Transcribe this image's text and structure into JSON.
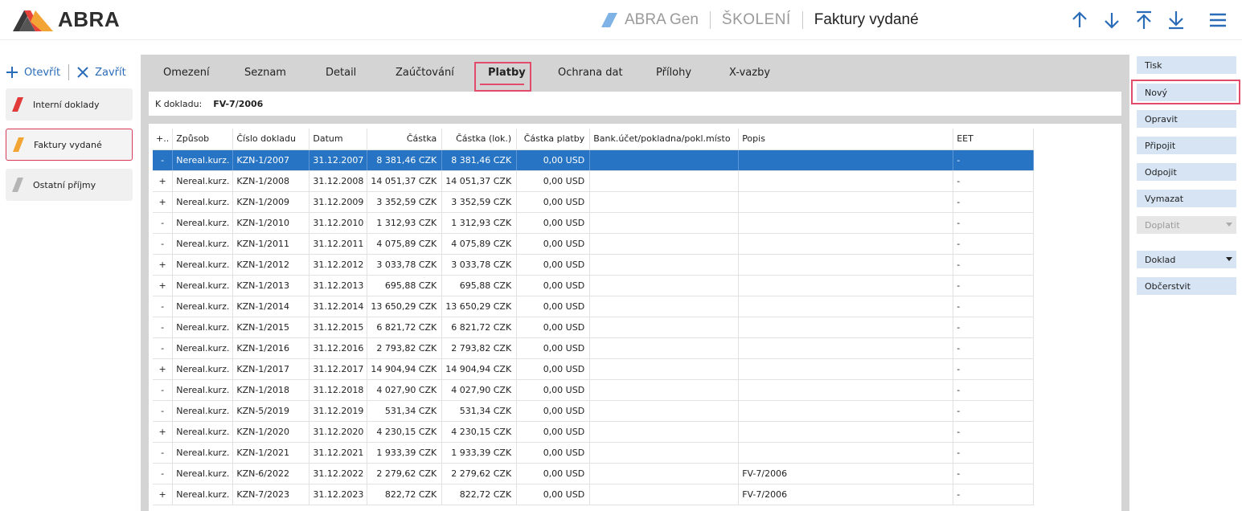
{
  "header": {
    "logo_text": "ABRA",
    "app_name": "ABRA Gen",
    "database": "ŠKOLENÍ",
    "title": "Faktury vydané",
    "nav_icons": [
      "arrow-up-icon",
      "arrow-down-icon",
      "arrow-first-icon",
      "arrow-last-icon",
      "menu-icon"
    ]
  },
  "colors": {
    "accent_blue": "#2b6cb8",
    "selected_row": "#2674c3",
    "highlight": "#e04c6a",
    "agenda_interni": "#e03a3a",
    "agenda_faktury": "#f2a535",
    "agenda_ostatni": "#b5b5b5"
  },
  "sidebar": {
    "open_label": "Otevřít",
    "close_label": "Zavřít",
    "items": [
      {
        "label": "Interní doklady",
        "icon": "red-stripe-icon"
      },
      {
        "label": "Faktury vydané",
        "icon": "orange-stripe-icon",
        "active": true
      },
      {
        "label": "Ostatní příjmy",
        "icon": "gray-stripe-icon"
      }
    ]
  },
  "tabs": [
    {
      "label": "Omezení"
    },
    {
      "label": "Seznam"
    },
    {
      "label": "Detail"
    },
    {
      "label": "Zaúčtování"
    },
    {
      "label": "Platby",
      "active": true
    },
    {
      "label": "Ochrana dat"
    },
    {
      "label": "Přílohy"
    },
    {
      "label": "X-vazby"
    }
  ],
  "doc": {
    "label": "K dokladu:",
    "value": "FV-7/2006"
  },
  "grid": {
    "columns": [
      "+..",
      "Způsob",
      "Číslo dokladu",
      "Datum",
      "Částka",
      "Částka (lok.)",
      "Částka platby",
      "Bank.účet/pokladna/pokl.místo",
      "Popis",
      "EET"
    ],
    "rows": [
      [
        "-",
        "Nereal.kurz.",
        "KZN-1/2007",
        "31.12.2007",
        "8 381,46 CZK",
        "8 381,46 CZK",
        "0,00 USD",
        "",
        "",
        "-"
      ],
      [
        "+",
        "Nereal.kurz.",
        "KZN-1/2008",
        "31.12.2008",
        "14 051,37 CZK",
        "14 051,37 CZK",
        "0,00 USD",
        "",
        "",
        "-"
      ],
      [
        "+",
        "Nereal.kurz.",
        "KZN-1/2009",
        "31.12.2009",
        "3 352,59 CZK",
        "3 352,59 CZK",
        "0,00 USD",
        "",
        "",
        "-"
      ],
      [
        "-",
        "Nereal.kurz.",
        "KZN-1/2010",
        "31.12.2010",
        "1 312,93 CZK",
        "1 312,93 CZK",
        "0,00 USD",
        "",
        "",
        "-"
      ],
      [
        "-",
        "Nereal.kurz.",
        "KZN-1/2011",
        "31.12.2011",
        "4 075,89 CZK",
        "4 075,89 CZK",
        "0,00 USD",
        "",
        "",
        "-"
      ],
      [
        "+",
        "Nereal.kurz.",
        "KZN-1/2012",
        "31.12.2012",
        "3 033,78 CZK",
        "3 033,78 CZK",
        "0,00 USD",
        "",
        "",
        "-"
      ],
      [
        "+",
        "Nereal.kurz.",
        "KZN-1/2013",
        "31.12.2013",
        "695,88 CZK",
        "695,88 CZK",
        "0,00 USD",
        "",
        "",
        "-"
      ],
      [
        "-",
        "Nereal.kurz.",
        "KZN-1/2014",
        "31.12.2014",
        "13 650,29 CZK",
        "13 650,29 CZK",
        "0,00 USD",
        "",
        "",
        "-"
      ],
      [
        "-",
        "Nereal.kurz.",
        "KZN-1/2015",
        "31.12.2015",
        "6 821,72 CZK",
        "6 821,72 CZK",
        "0,00 USD",
        "",
        "",
        "-"
      ],
      [
        "-",
        "Nereal.kurz.",
        "KZN-1/2016",
        "31.12.2016",
        "2 793,82 CZK",
        "2 793,82 CZK",
        "0,00 USD",
        "",
        "",
        "-"
      ],
      [
        "+",
        "Nereal.kurz.",
        "KZN-1/2017",
        "31.12.2017",
        "14 904,94 CZK",
        "14 904,94 CZK",
        "0,00 USD",
        "",
        "",
        "-"
      ],
      [
        "-",
        "Nereal.kurz.",
        "KZN-1/2018",
        "31.12.2018",
        "4 027,90 CZK",
        "4 027,90 CZK",
        "0,00 USD",
        "",
        "",
        "-"
      ],
      [
        "-",
        "Nereal.kurz.",
        "KZN-5/2019",
        "31.12.2019",
        "531,34 CZK",
        "531,34 CZK",
        "0,00 USD",
        "",
        "",
        "-"
      ],
      [
        "+",
        "Nereal.kurz.",
        "KZN-1/2020",
        "31.12.2020",
        "4 230,15 CZK",
        "4 230,15 CZK",
        "0,00 USD",
        "",
        "",
        "-"
      ],
      [
        "-",
        "Nereal.kurz.",
        "KZN-1/2021",
        "31.12.2021",
        "1 933,39 CZK",
        "1 933,39 CZK",
        "0,00 USD",
        "",
        "",
        "-"
      ],
      [
        "-",
        "Nereal.kurz.",
        "KZN-6/2022",
        "31.12.2022",
        "2 279,62 CZK",
        "2 279,62 CZK",
        "0,00 USD",
        "",
        "FV-7/2006",
        "-"
      ],
      [
        "+",
        "Nereal.kurz.",
        "KZN-7/2023",
        "31.12.2023",
        "822,72 CZK",
        "822,72 CZK",
        "0,00 USD",
        "",
        "FV-7/2006",
        "-"
      ]
    ]
  },
  "actions": [
    {
      "label": "Tisk"
    },
    {
      "label": "Nový",
      "highlighted": true
    },
    {
      "label": "Opravit"
    },
    {
      "label": "Připojit"
    },
    {
      "label": "Odpojit"
    },
    {
      "label": "Vymazat"
    },
    {
      "label": "Doplatit",
      "disabled": true,
      "dropdown": true
    },
    {
      "label": "Doklad",
      "dropdown": true
    },
    {
      "label": "Občerstvit"
    }
  ]
}
